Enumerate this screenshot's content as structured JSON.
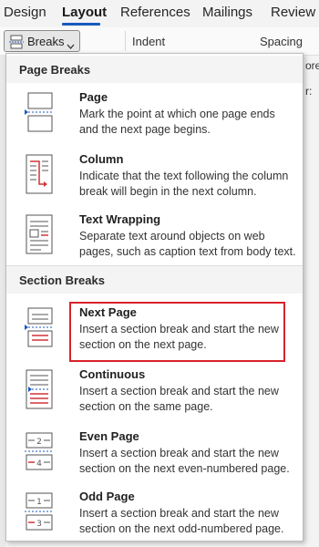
{
  "ribbon_tabs": [
    "Design",
    "Layout",
    "References",
    "Mailings",
    "Review"
  ],
  "active_tab": "Layout",
  "ribbon": {
    "breaks_label": "Breaks",
    "indent_label": "Indent",
    "spacing_label": "Spacing",
    "bg_text_1": "ore",
    "bg_text_2": "r:"
  },
  "menu": {
    "page_breaks_header": "Page Breaks",
    "section_breaks_header": "Section Breaks",
    "items": [
      {
        "title": "Page",
        "description": "Mark the point at which one page ends\nand the next page begins.",
        "icon": "page-break-icon"
      },
      {
        "title": "Column",
        "description": "Indicate that the text following the column\nbreak will begin in the next column.",
        "icon": "column-break-icon"
      },
      {
        "title": "Text Wrapping",
        "description": "Separate text around objects on web\npages, such as caption text from body text.",
        "icon": "text-wrapping-icon"
      },
      {
        "title": "Next Page",
        "description": "Insert a section break and start the new\nsection on the next page.",
        "icon": "next-page-icon"
      },
      {
        "title": "Continuous",
        "description": "Insert a section break and start the new\nsection on the same page.",
        "icon": "continuous-icon"
      },
      {
        "title": "Even Page",
        "description": "Insert a section break and start the new\nsection on the next even-numbered page.",
        "icon": "even-page-icon"
      },
      {
        "title": "Odd Page",
        "description": "Insert a section break and start the new\nsection on the next odd-numbered page.",
        "icon": "odd-page-icon"
      }
    ]
  },
  "colors": {
    "accent": "#185abd",
    "highlight": "#d9222a",
    "icon_red": "#d13438"
  }
}
